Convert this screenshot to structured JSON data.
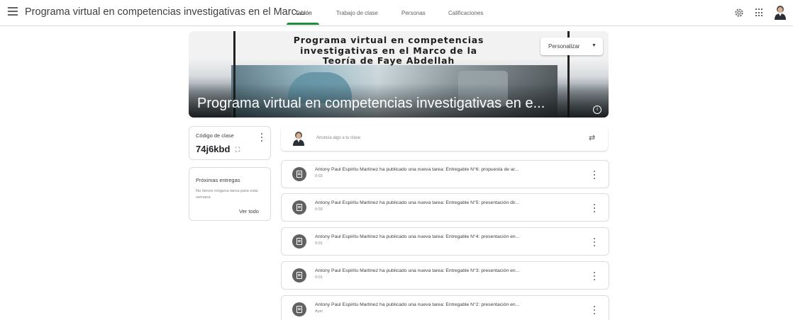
{
  "header": {
    "title": "Programa virtual en competencias investigativas en el Marc...",
    "tabs": [
      {
        "label": "Tablón"
      },
      {
        "label": "Trabajo de clase"
      },
      {
        "label": "Personas"
      },
      {
        "label": "Calificaciones"
      }
    ],
    "active_tab": "Tablón"
  },
  "banner": {
    "heading_lines": [
      "Programa virtual en competencias",
      "investigativas en el Marco de la",
      "Teoría de Faye Abdellah"
    ],
    "title": "Programa virtual en competencias investigativas en e...",
    "customize_label": "Personalizar",
    "info_icon_glyph": "i"
  },
  "class_code": {
    "label": "Código de clase",
    "value": "74j6kbd",
    "fullscreen_glyph": "⛶"
  },
  "upcoming": {
    "title": "Próximas entregas",
    "empty_message": "No tienes ninguna tarea para esta semana",
    "view_all_label": "Ver todo"
  },
  "announce": {
    "placeholder": "Anuncia algo a tu clase",
    "repost_glyph": "⇄"
  },
  "posts": [
    {
      "text": "Antony Paul Espiritu Martinez ha publicado una nueva tarea: Entregable N°6: propuesta de ar...",
      "time": "0:03"
    },
    {
      "text": "Antony Paul Espiritu Martinez ha publicado una nueva tarea: Entregable N°5: presentación dir...",
      "time": "0:03"
    },
    {
      "text": "Antony Paul Espiritu Martinez ha publicado una nueva tarea: Entregable N°4: presentación en...",
      "time": "0:01"
    },
    {
      "text": "Antony Paul Espiritu Martinez ha publicado una nueva tarea: Entregable N°3: presentación en...",
      "time": "0:01"
    },
    {
      "text": "Antony Paul Espiritu Martinez ha publicado una nueva tarea: Entregable N°2: presentación en...",
      "time": "Ayer"
    }
  ],
  "colors": {
    "accent_green": "#1e8e3e",
    "post_icon": "#616161"
  },
  "icons": [
    "menu-icon",
    "gear-icon",
    "apps-grid-icon",
    "avatar",
    "info-icon",
    "kebab-icon",
    "fullscreen-icon",
    "repost-icon",
    "assignment-icon"
  ]
}
